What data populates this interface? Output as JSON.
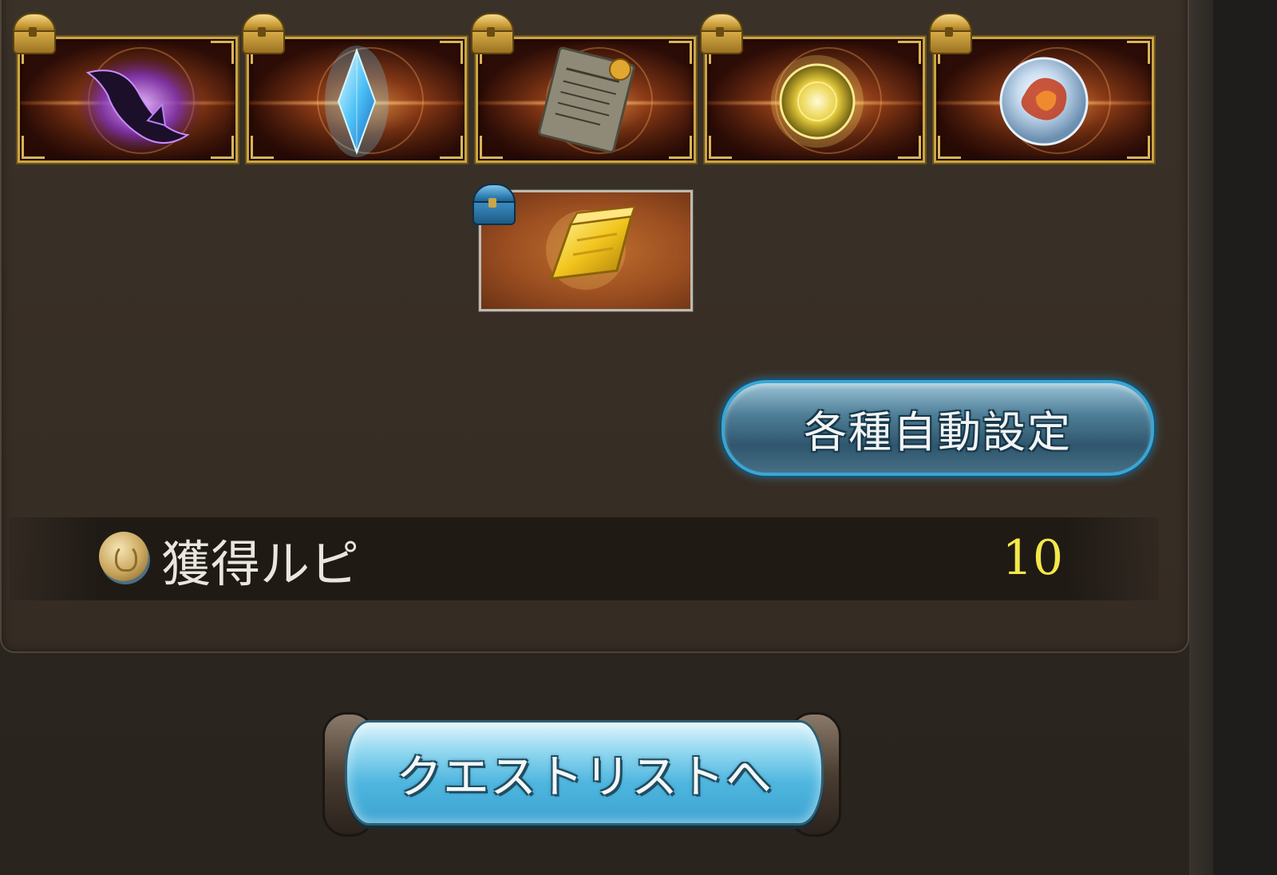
{
  "rewards": [
    {
      "name": "dark-horn",
      "chest": "gold"
    },
    {
      "name": "blue-crystal",
      "chest": "gold"
    },
    {
      "name": "scroll",
      "chest": "gold"
    },
    {
      "name": "light-orb",
      "chest": "gold"
    },
    {
      "name": "fire-orb",
      "chest": "gold"
    },
    {
      "name": "gold-bar",
      "chest": "blue"
    }
  ],
  "auto_settings": {
    "label": "各種自動設定"
  },
  "rupee": {
    "label": "獲得ルピ",
    "value": "10"
  },
  "quest_list": {
    "label": "クエストリストへ"
  },
  "colors": {
    "panel": "#352c24",
    "card_border": "#c9a548",
    "rupee_value": "#f4e84a",
    "button_glow": "#3aa6d4"
  }
}
